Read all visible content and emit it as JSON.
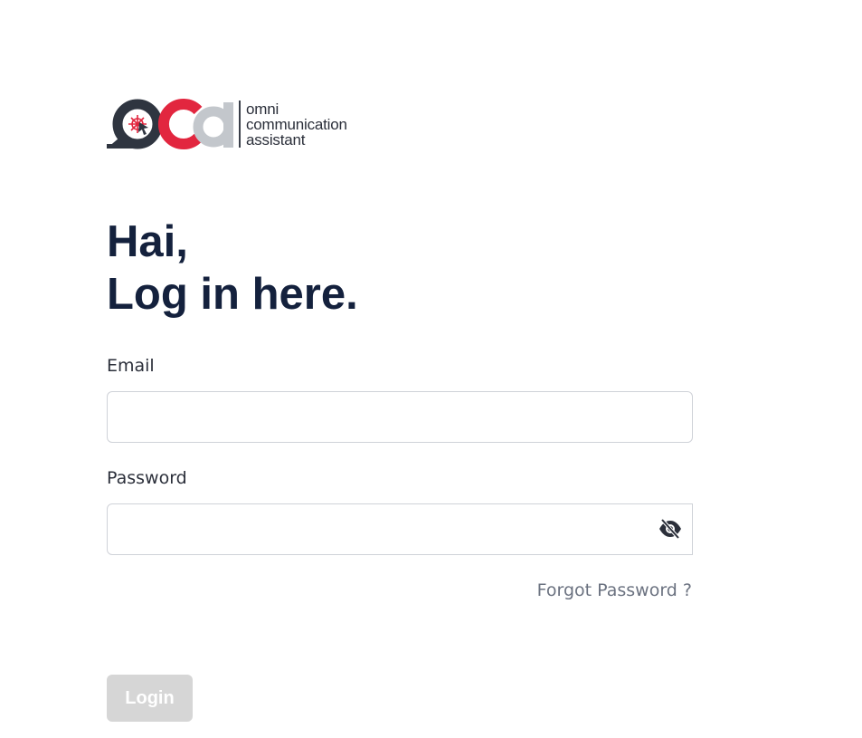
{
  "logo": {
    "brand_line1": "omni",
    "brand_line2": "communication",
    "brand_line3": "assistant",
    "colors": {
      "dark": "#2f3540",
      "red": "#e2263f",
      "gray": "#c3c7cc"
    }
  },
  "heading": {
    "line1": "Hai,",
    "line2": "Log in here."
  },
  "form": {
    "email_label": "Email",
    "email_value": "",
    "email_placeholder": "",
    "password_label": "Password",
    "password_value": "",
    "password_placeholder": "",
    "password_toggle_icon": "eye-slash-icon",
    "forgot_label": "Forgot Password ?",
    "login_label": "Login",
    "login_disabled": true
  },
  "colors": {
    "heading": "#14213d",
    "label": "#2b2f3a",
    "muted": "#6b7280",
    "button_disabled_bg": "#d6d6d6"
  }
}
